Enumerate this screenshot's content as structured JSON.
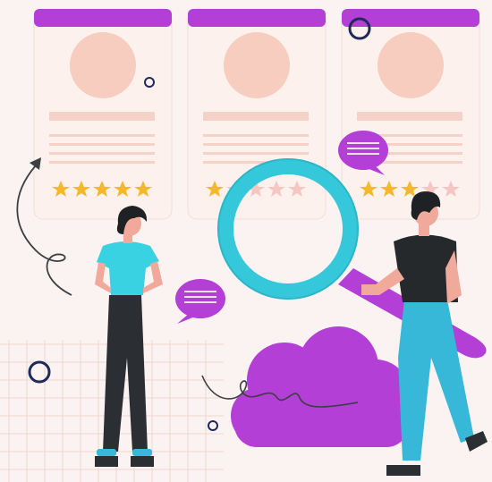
{
  "palette": {
    "background": "#fbf3f1",
    "grid_line": "#f0d5d1",
    "card_body": "#fdf1ee",
    "card_header": "#b43fd6",
    "avatar": "#f6cdbf",
    "text_placeholder": "#f4d2c7",
    "star_filled": "#f5b72c",
    "star_empty": "#f6c6c2",
    "magnifier_ring": "#35c8db",
    "magnifier_handle": "#b43fd6",
    "speech_bubble": "#b43fd6",
    "cloud": "#b43fd6",
    "shirt_cyan": "#39d2e3",
    "pants_dark": "#2b2f33",
    "shirt_dark": "#26292c",
    "pants_cyan": "#38b8d9",
    "skin": "#f0a99a",
    "hair": "#1f2225",
    "circle_outline": "#1e2a5a",
    "scribble": "#3c3f44"
  },
  "cards": [
    {
      "name": "review-card-1",
      "rating": 5,
      "out_of": 5
    },
    {
      "name": "review-card-2",
      "rating": 1,
      "out_of": 5
    },
    {
      "name": "review-card-3",
      "rating": 3,
      "out_of": 5
    }
  ],
  "icons": [
    "review-card-icon",
    "star-icon",
    "magnifying-glass-icon",
    "speech-bubble-icon",
    "cloud-icon",
    "arrow-icon",
    "person-icon"
  ]
}
